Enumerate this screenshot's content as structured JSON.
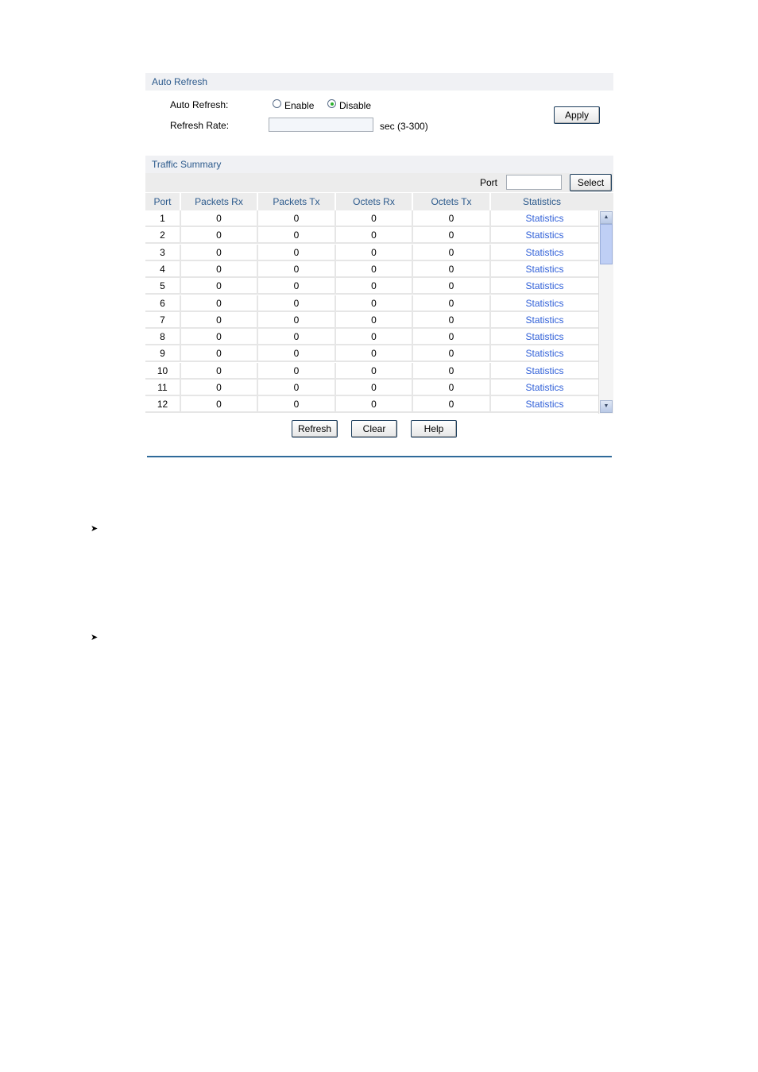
{
  "auto_refresh_section": {
    "title": "Auto Refresh",
    "auto_refresh_label": "Auto Refresh:",
    "enable_label": "Enable",
    "disable_label": "Disable",
    "selected": "Disable",
    "refresh_rate_label": "Refresh Rate:",
    "refresh_rate_value": "",
    "refresh_rate_hint": "sec (3-300)",
    "apply_label": "Apply"
  },
  "traffic_summary": {
    "title": "Traffic Summary",
    "port_filter_label": "Port",
    "port_filter_value": "",
    "select_label": "Select",
    "columns": [
      "Port",
      "Packets Rx",
      "Packets Tx",
      "Octets Rx",
      "Octets Tx",
      "Statistics"
    ],
    "rows": [
      {
        "port": "1",
        "packets_rx": "0",
        "packets_tx": "0",
        "octets_rx": "0",
        "octets_tx": "0",
        "link": "Statistics"
      },
      {
        "port": "2",
        "packets_rx": "0",
        "packets_tx": "0",
        "octets_rx": "0",
        "octets_tx": "0",
        "link": "Statistics"
      },
      {
        "port": "3",
        "packets_rx": "0",
        "packets_tx": "0",
        "octets_rx": "0",
        "octets_tx": "0",
        "link": "Statistics"
      },
      {
        "port": "4",
        "packets_rx": "0",
        "packets_tx": "0",
        "octets_rx": "0",
        "octets_tx": "0",
        "link": "Statistics"
      },
      {
        "port": "5",
        "packets_rx": "0",
        "packets_tx": "0",
        "octets_rx": "0",
        "octets_tx": "0",
        "link": "Statistics"
      },
      {
        "port": "6",
        "packets_rx": "0",
        "packets_tx": "0",
        "octets_rx": "0",
        "octets_tx": "0",
        "link": "Statistics"
      },
      {
        "port": "7",
        "packets_rx": "0",
        "packets_tx": "0",
        "octets_rx": "0",
        "octets_tx": "0",
        "link": "Statistics"
      },
      {
        "port": "8",
        "packets_rx": "0",
        "packets_tx": "0",
        "octets_rx": "0",
        "octets_tx": "0",
        "link": "Statistics"
      },
      {
        "port": "9",
        "packets_rx": "0",
        "packets_tx": "0",
        "octets_rx": "0",
        "octets_tx": "0",
        "link": "Statistics"
      },
      {
        "port": "10",
        "packets_rx": "0",
        "packets_tx": "0",
        "octets_rx": "0",
        "octets_tx": "0",
        "link": "Statistics"
      },
      {
        "port": "11",
        "packets_rx": "0",
        "packets_tx": "0",
        "octets_rx": "0",
        "octets_tx": "0",
        "link": "Statistics"
      },
      {
        "port": "12",
        "packets_rx": "0",
        "packets_tx": "0",
        "octets_rx": "0",
        "octets_tx": "0",
        "link": "Statistics"
      }
    ],
    "buttons": {
      "refresh": "Refresh",
      "clear": "Clear",
      "help": "Help"
    }
  },
  "bullets": [
    "➤",
    "➤"
  ],
  "icons": {
    "scroll_up": "▲",
    "scroll_down": "▼"
  }
}
